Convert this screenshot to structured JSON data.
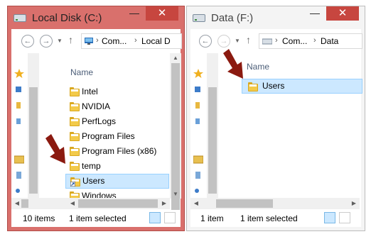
{
  "left_window": {
    "title": "Local Disk (C:)",
    "close": "✕",
    "minimize": "—",
    "address": [
      "Com...",
      "Local D"
    ],
    "column_header": "Name",
    "items": [
      {
        "label": "Intel",
        "selected": false,
        "shortcut": false
      },
      {
        "label": "NVIDIA",
        "selected": false,
        "shortcut": false
      },
      {
        "label": "PerfLogs",
        "selected": false,
        "shortcut": false
      },
      {
        "label": "Program Files",
        "selected": false,
        "shortcut": false
      },
      {
        "label": "Program Files (x86)",
        "selected": false,
        "shortcut": false
      },
      {
        "label": "temp",
        "selected": false,
        "shortcut": false
      },
      {
        "label": "Users",
        "selected": true,
        "shortcut": true
      },
      {
        "label": "Windows",
        "selected": false,
        "shortcut": false
      }
    ],
    "status_count": "10 items",
    "status_selected": "1 item selected"
  },
  "right_window": {
    "title": "Data (F:)",
    "close": "✕",
    "minimize": "—",
    "address": [
      "Com...",
      "Data"
    ],
    "column_header": "Name",
    "items": [
      {
        "label": "Users",
        "selected": true,
        "shortcut": false
      }
    ],
    "status_count": "1 item",
    "status_selected": "1 item selected"
  },
  "glyphs": {
    "back": "←",
    "forward": "→",
    "up": "↑",
    "dropdown": "▼",
    "separator": "›",
    "scroll_up": "▲",
    "scroll_down": "▼",
    "scroll_left": "◀",
    "scroll_right": "▶"
  },
  "colors": {
    "left_frame": "#d9706c",
    "right_frame": "#f4f4f4",
    "close_button": "#c7463f",
    "selection": "#cce8ff",
    "annotation_arrow": "#8b1a10"
  }
}
